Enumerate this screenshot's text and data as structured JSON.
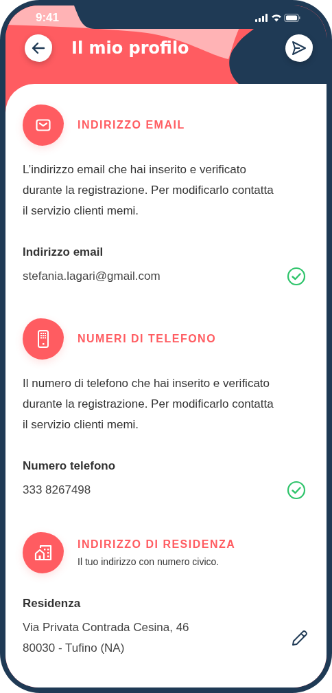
{
  "status_bar": {
    "time": "9:41"
  },
  "header": {
    "title": "Il mio profilo"
  },
  "sections": [
    {
      "kind": "email",
      "title": "INDIRIZZO EMAIL",
      "description": "L’indirizzo email che hai inserito e verificato durante la registrazione. Per modificarlo contatta il servizio clienti memi.",
      "field_label": "Indirizzo email",
      "value_lines": [
        "stefania.lagari@gmail.com"
      ],
      "verified": true,
      "editable": false
    },
    {
      "kind": "phone",
      "title": "NUMERI DI TELEFONO",
      "description": "Il numero di telefono che hai inserito e verificato durante la registrazione. Per modificarlo contatta il servizio clienti memi.",
      "field_label": "Numero telefono",
      "value_lines": [
        "333 8267498"
      ],
      "verified": true,
      "editable": false
    },
    {
      "kind": "home",
      "title": "INDIRIZZO DI RESIDENZA",
      "subtitle": "Il tuo indirizzo con numero civico.",
      "field_label": "Residenza",
      "value_lines": [
        "Via Privata Contrada Cesina, 46",
        "80030 - Tufino (NA)"
      ],
      "verified": false,
      "editable": true
    }
  ]
}
